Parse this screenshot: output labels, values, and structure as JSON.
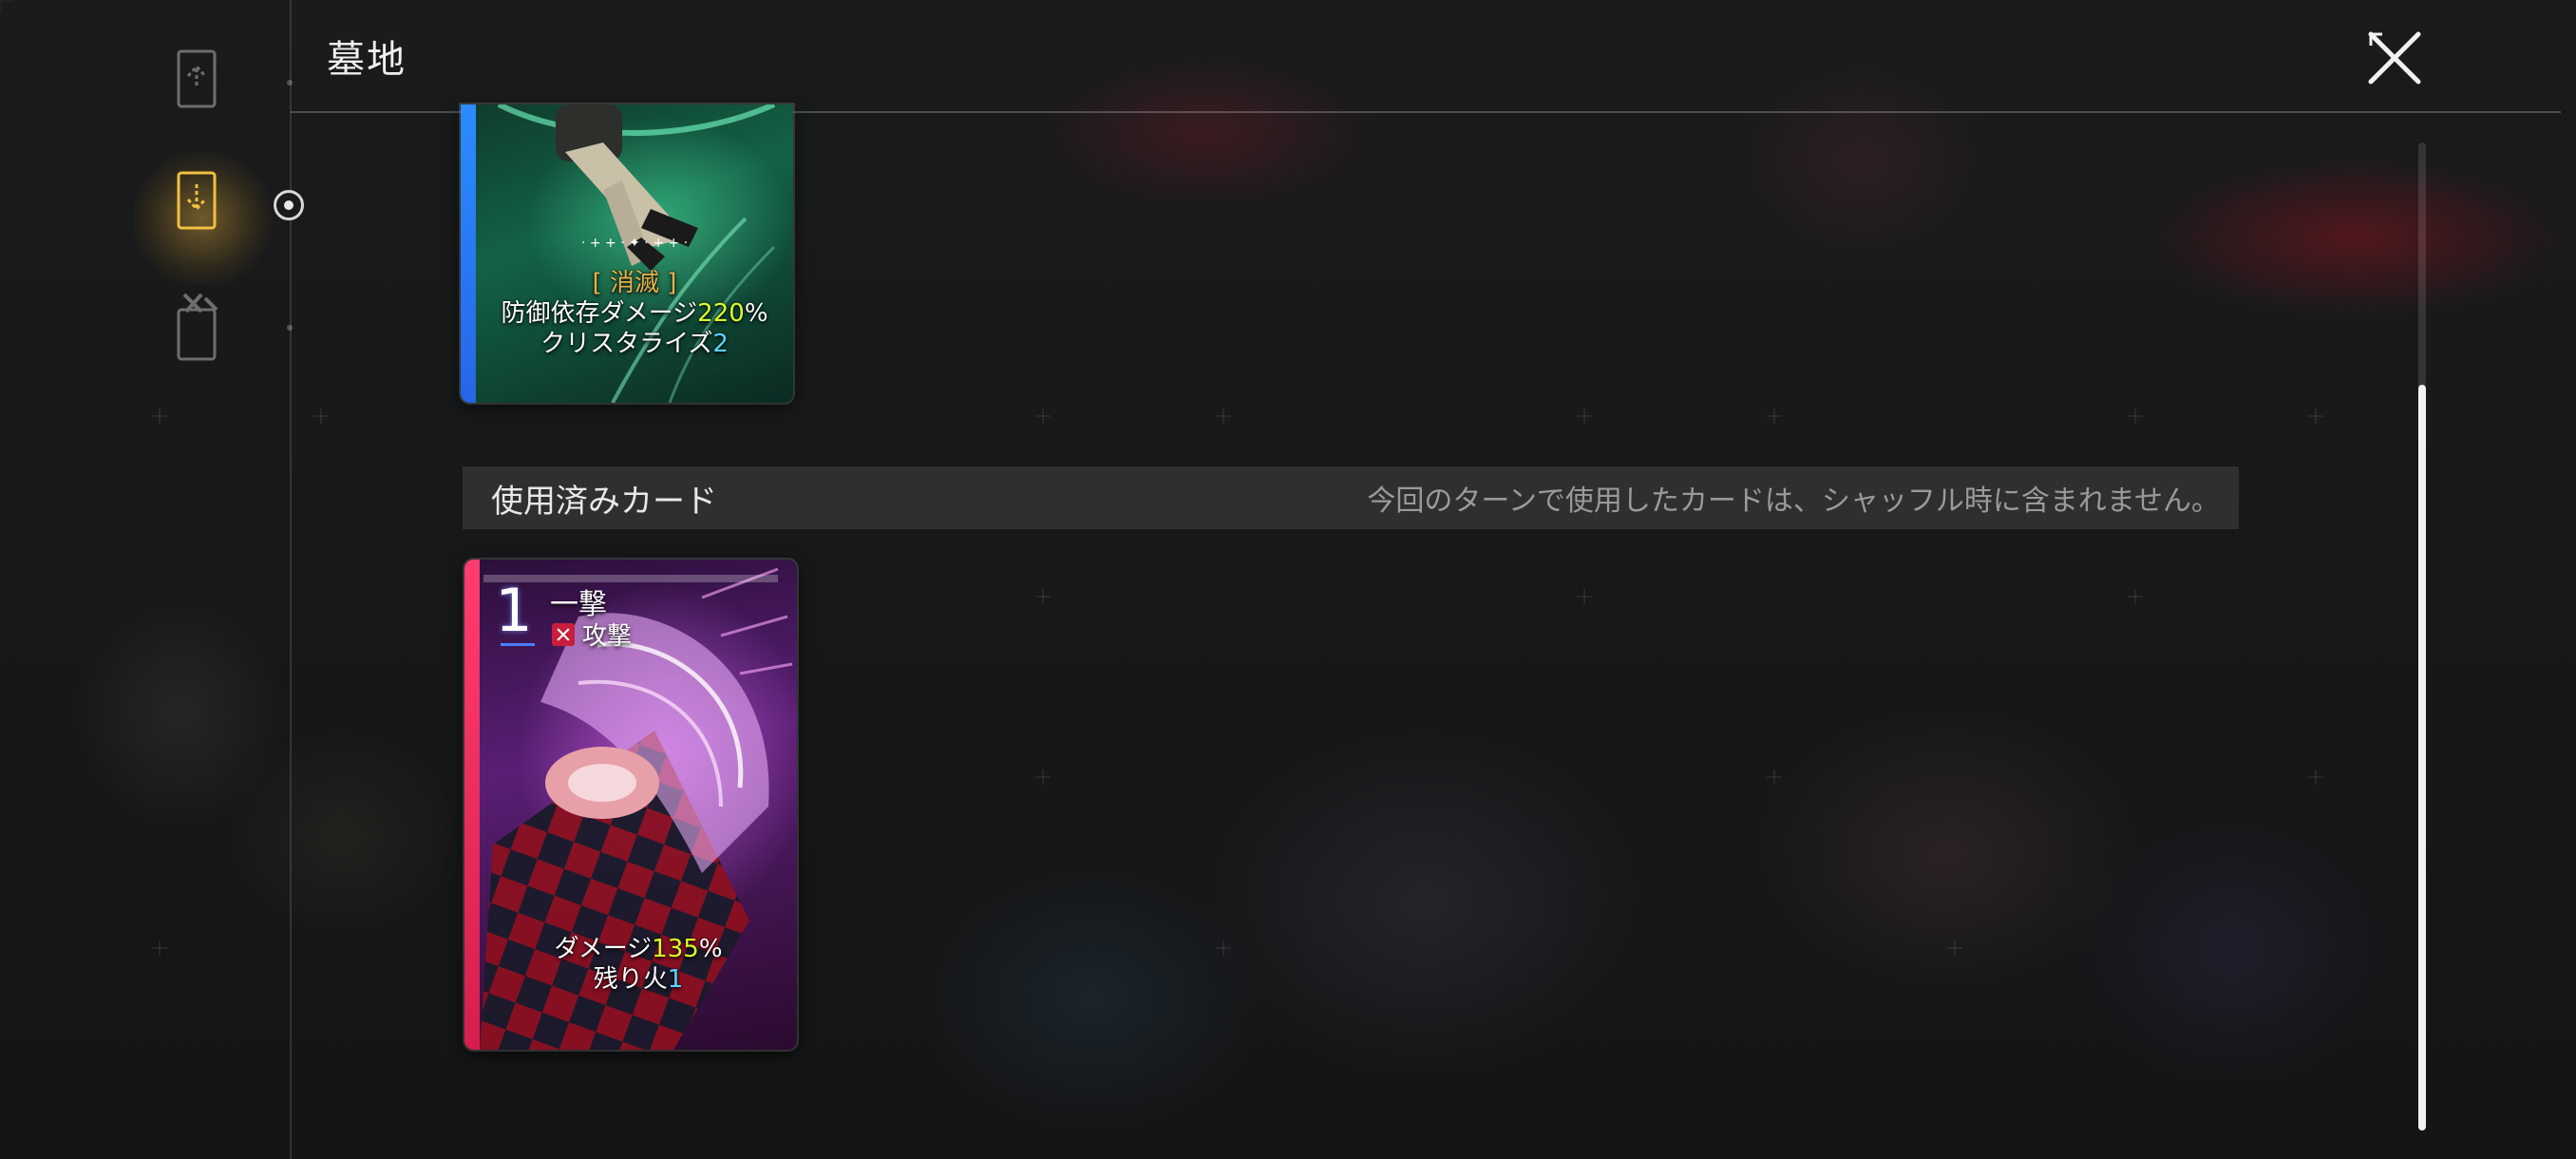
{
  "header": {
    "title": "墓地"
  },
  "sidebar": {
    "items": [
      {
        "name": "draw-pile",
        "icon": "deck-up-icon",
        "active": false
      },
      {
        "name": "graveyard",
        "icon": "deck-down-icon",
        "active": true
      },
      {
        "name": "removed-pile",
        "icon": "card-tools-icon",
        "active": false
      }
    ]
  },
  "cards_top": {
    "tag": "[ 消滅 ]",
    "line1_prefix": "防御依存ダメージ",
    "line1_value": "220",
    "line1_suffix": "%",
    "line2_prefix": "クリスタライズ",
    "line2_value": "2"
  },
  "section": {
    "title": "使用済みカード",
    "description": "今回のターンで使用したカードは、シャッフル時に含まれません。"
  },
  "cards_used": [
    {
      "cost": "1",
      "name": "一撃",
      "type": "攻撃",
      "line1_prefix": "ダメージ",
      "line1_value": "135",
      "line1_suffix": "%",
      "line2_prefix": "残り火",
      "line2_value": "1"
    }
  ],
  "colors": {
    "accent_gold": "#e0b040",
    "highlight_value": "#d8ff2a",
    "highlight_blue": "#5ad6ff",
    "card_stripe_blue": "#2a8cff",
    "card_stripe_red": "#ff3d6e"
  }
}
